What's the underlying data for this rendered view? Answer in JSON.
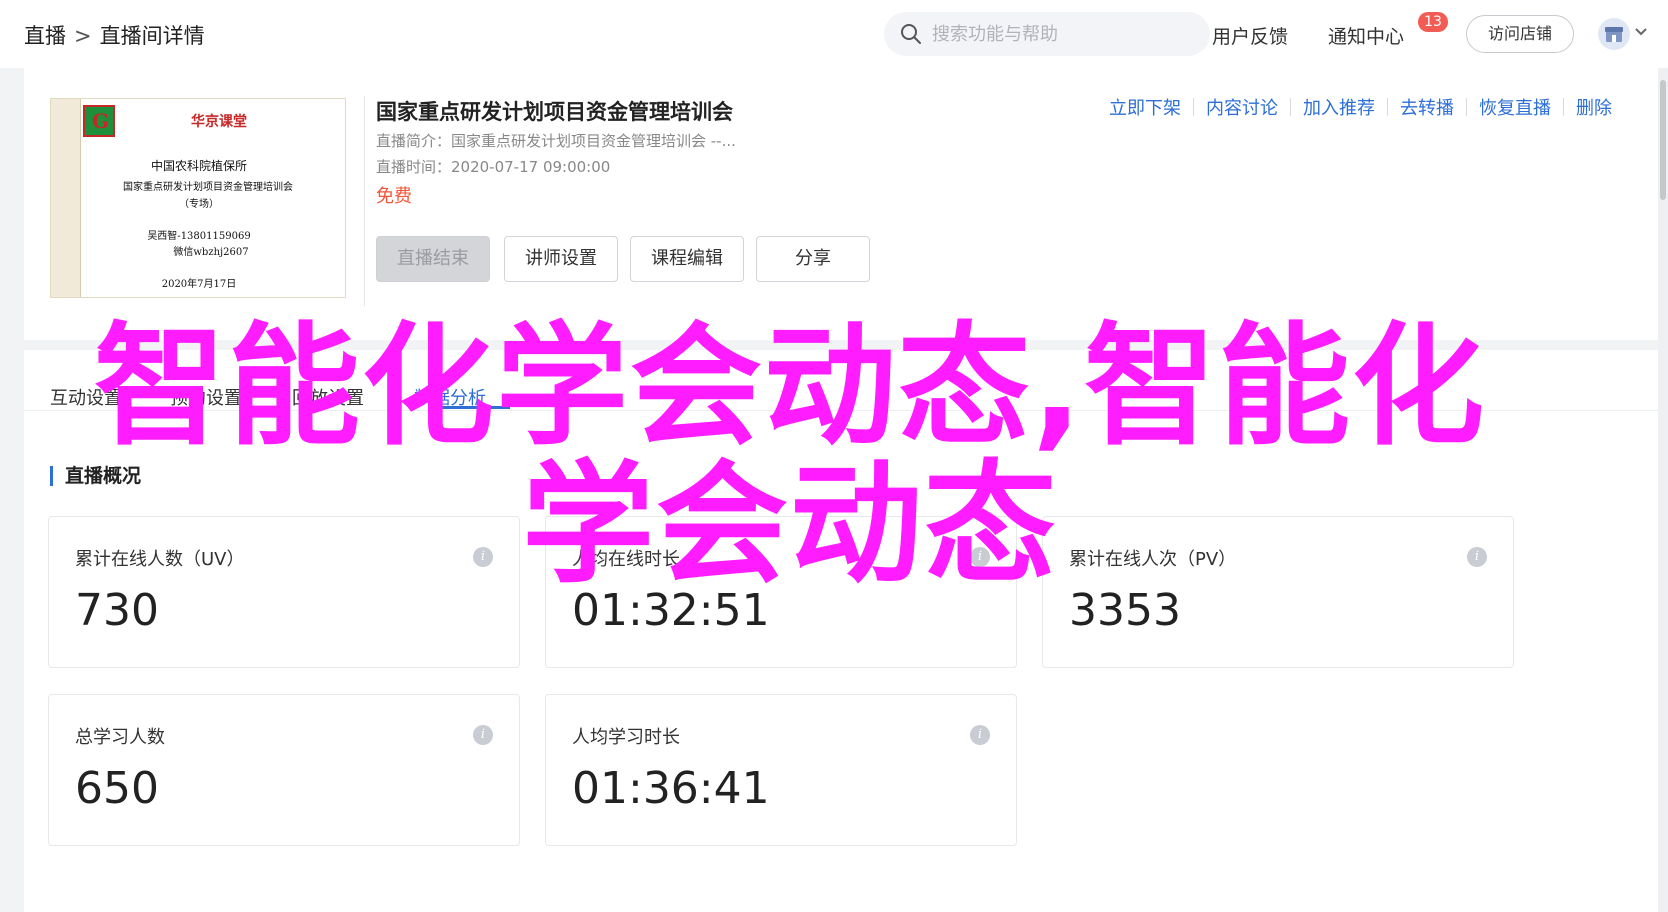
{
  "header": {
    "breadcrumb": [
      "直播",
      "直播间详情"
    ],
    "breadcrumb_separator": ">",
    "search_placeholder": "搜索功能与帮助",
    "feedback": "用户反馈",
    "notifications": "通知中心",
    "notification_count": "13",
    "visit_store": "访问店铺"
  },
  "course": {
    "title": "国家重点研发计划项目资金管理培训会",
    "intro": "直播简介：国家重点研发计划项目资金管理培训会 --...",
    "time": "直播时间：2020-07-17 09:00:00",
    "price": "免费",
    "buttons": [
      "直播结束",
      "讲师设置",
      "课程编辑",
      "分享"
    ],
    "actions": [
      "立即下架",
      "内容讨论",
      "加入推荐",
      "去转播",
      "恢复直播",
      "删除"
    ],
    "cover": {
      "title": "华京课堂",
      "org": "中国农科院植保所",
      "project": "国家重点研发计划项目资金管理培训会",
      "special": "（专场）",
      "phone": "吴西智-13801159069",
      "wechat": "微信wbzhj2607",
      "date": "2020年7月17日"
    }
  },
  "tabs": [
    {
      "label": "互动设置",
      "active": false
    },
    {
      "label": "预约设置",
      "active": false
    },
    {
      "label": "回放设置",
      "active": false
    },
    {
      "label": "数据分析",
      "active": true
    }
  ],
  "overview": {
    "title": "直播概况",
    "stats": [
      {
        "label": "累计在线人数（UV）",
        "value": "730"
      },
      {
        "label": "人均在线时长",
        "value": "01:32:51"
      },
      {
        "label": "累计在线人次（PV）",
        "value": "3353"
      },
      {
        "label": "总学习人数",
        "value": "650"
      },
      {
        "label": "人均学习时长",
        "value": "01:36:41"
      }
    ]
  },
  "overlay": {
    "line1": "智能化学会动态,智能化",
    "line2": "学会动态"
  },
  "colors": {
    "accent": "#2d6fd6",
    "price": "#f2553a",
    "badge": "#f25c54",
    "overlay": "#ff1cff"
  }
}
